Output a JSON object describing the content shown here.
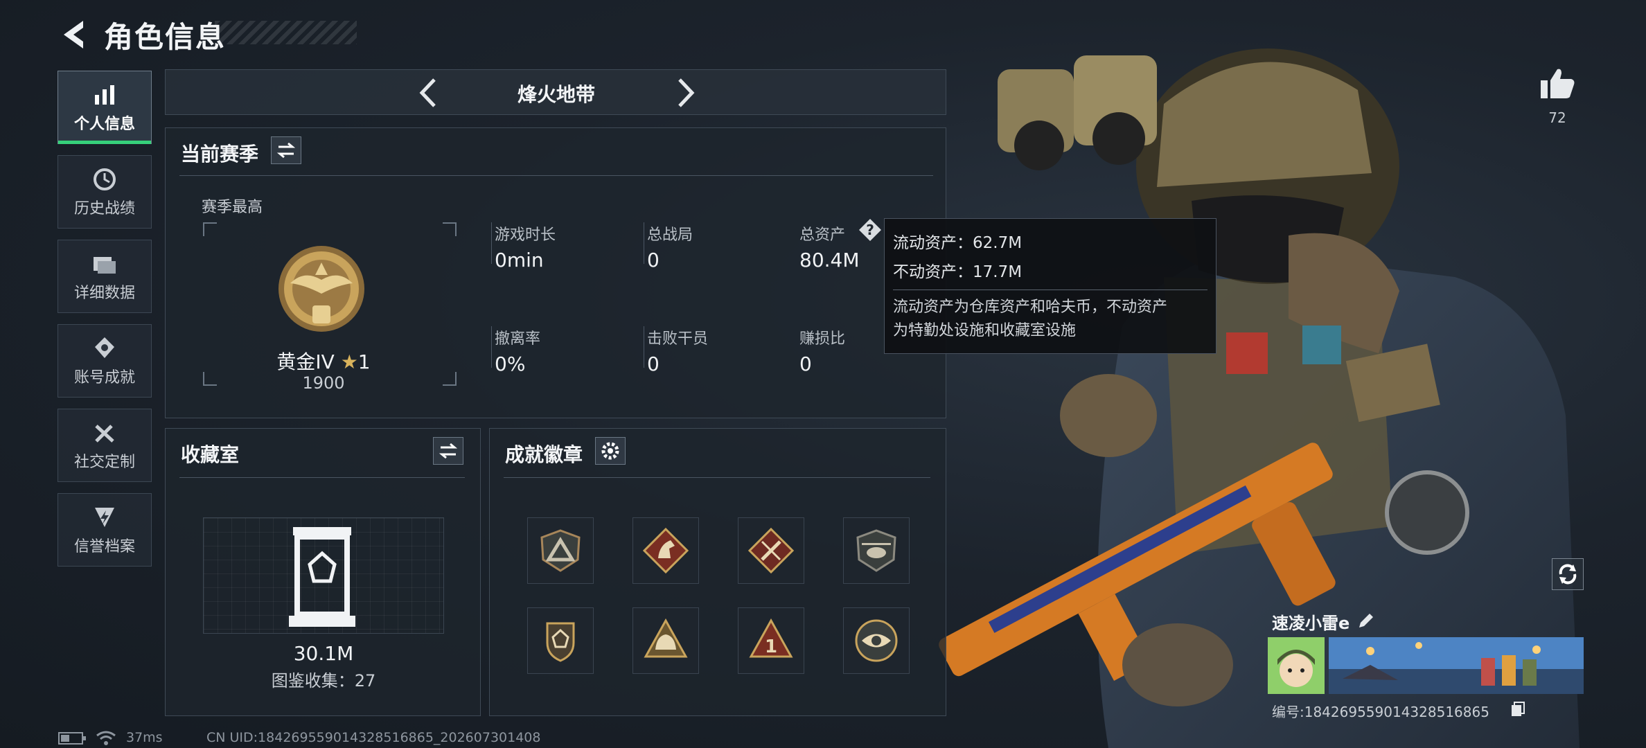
{
  "header": {
    "title": "角色信息"
  },
  "nav": [
    {
      "label": "个人信息",
      "icon": "bar-chart-icon",
      "active": true
    },
    {
      "label": "历史战绩",
      "icon": "history-icon",
      "active": false
    },
    {
      "label": "详细数据",
      "icon": "folder-icon",
      "active": false
    },
    {
      "label": "账号成就",
      "icon": "achievement-icon",
      "active": false
    },
    {
      "label": "社交定制",
      "icon": "tools-icon",
      "active": false
    },
    {
      "label": "信誉档案",
      "icon": "shield-bolt-icon",
      "active": false
    }
  ],
  "mode": {
    "name": "烽火地带"
  },
  "season": {
    "title": "当前赛季",
    "best_label": "赛季最高",
    "rank_name": "黄金IV",
    "rank_stars": "1",
    "rank_score": "1900",
    "stats": [
      {
        "label": "游戏时长",
        "value": "0min"
      },
      {
        "label": "总战局",
        "value": "0"
      },
      {
        "label": "总资产",
        "value": "80.4M"
      },
      {
        "label": "撤离率",
        "value": "0%"
      },
      {
        "label": "击败干员",
        "value": "0"
      },
      {
        "label": "赚损比",
        "value": "0"
      }
    ]
  },
  "tooltip": {
    "liquid": "流动资产：62.7M",
    "fixed": "不动资产：17.7M",
    "desc_line1": "流动资产为仓库资产和哈夫币，不动资产",
    "desc_line2": "为特勤处设施和收藏室设施"
  },
  "collection": {
    "title": "收藏室",
    "value": "30.1M",
    "count_text": "图鉴收集：27"
  },
  "badges": {
    "title": "成就徽章",
    "items": [
      {
        "icon": "triangle-badge-icon"
      },
      {
        "icon": "horse-badge-icon"
      },
      {
        "icon": "crossed-tools-badge-icon"
      },
      {
        "icon": "helicopter-badge-icon"
      },
      {
        "icon": "shield-badge-icon"
      },
      {
        "icon": "helmet-badge-icon"
      },
      {
        "icon": "number-one-badge-icon"
      },
      {
        "icon": "eye-badge-icon"
      }
    ],
    "number_badge_text": "1"
  },
  "likes": {
    "count": "72"
  },
  "player": {
    "name": "速凌小雷e",
    "id_text": "编号:184269559014328516865"
  },
  "footer": {
    "ping": "37ms",
    "uid": "CN UID:184269559014328516865_202607301408"
  },
  "colors": {
    "accent_green": "#36d07a",
    "gold": "#c9a45c",
    "bronze": "#a7865a"
  }
}
